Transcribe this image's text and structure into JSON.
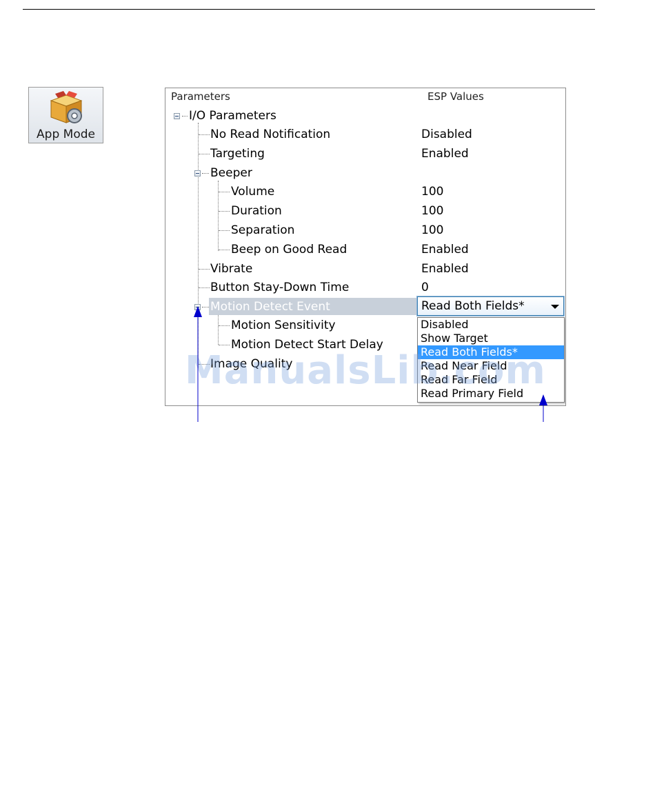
{
  "app_mode": {
    "label": "App Mode",
    "icon": "app-mode-box-gear-icon"
  },
  "panel": {
    "header_parameters": "Parameters",
    "header_values": "ESP Values"
  },
  "tree": {
    "io_parameters": "I/O Parameters",
    "no_read_notification": {
      "label": "No Read Notification",
      "value": "Disabled"
    },
    "targeting": {
      "label": "Targeting",
      "value": "Enabled"
    },
    "beeper": "Beeper",
    "volume": {
      "label": "Volume",
      "value": "100"
    },
    "duration": {
      "label": "Duration",
      "value": "100"
    },
    "separation": {
      "label": "Separation",
      "value": "100"
    },
    "beep_on_good_read": {
      "label": "Beep on Good Read",
      "value": "Enabled"
    },
    "vibrate": {
      "label": "Vibrate",
      "value": "Enabled"
    },
    "button_stay_down": {
      "label": "Button Stay-Down Time",
      "value": "0"
    },
    "motion_detect_event": {
      "label": "Motion Detect Event",
      "value": "Read Both Fields*"
    },
    "motion_sensitivity": "Motion Sensitivity",
    "motion_detect_start_delay": "Motion Detect Start Delay",
    "image_quality": "Image Quality"
  },
  "dropdown": {
    "selected": "Read Both Fields*",
    "options": [
      "Disabled",
      "Show Target",
      "Read Both Fields*",
      "Read Near Field",
      "Read Far Field",
      "Read Primary Field"
    ]
  },
  "watermark": "ManualsLib.com",
  "colors": {
    "selection": "#3399ff",
    "row_highlight": "#c8d0da",
    "arrow": "#0000cc"
  }
}
